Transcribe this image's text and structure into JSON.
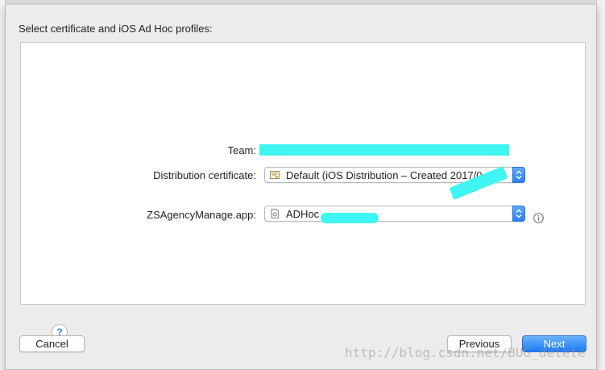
{
  "dialog": {
    "header": "Select certificate and iOS Ad Hoc profiles:",
    "team": {
      "label": "Team:"
    },
    "certificate": {
      "label": "Distribution certificate:",
      "value": "Default (iOS Distribution – Created 2017/0"
    },
    "profile": {
      "label": "ZSAgencyManage.app:",
      "value": "ADHoc"
    },
    "help_label": "?",
    "buttons": {
      "cancel": "Cancel",
      "previous": "Previous",
      "next": "Next"
    }
  },
  "watermark": "http://blog.csdn.net/BUG_delete",
  "colors": {
    "accent": "#2f7ff5",
    "redaction": "#3ff5f2",
    "sheet_background": "#ececec"
  }
}
